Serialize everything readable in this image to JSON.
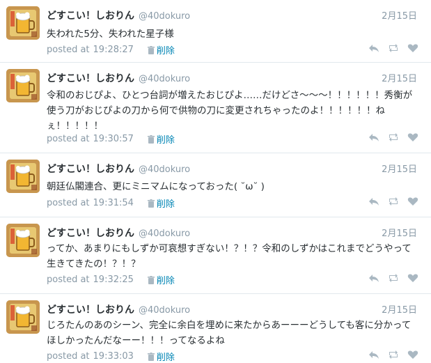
{
  "tweets": [
    {
      "name": "どすこい！しおりん",
      "handle": "@40dokuro",
      "date": "2月15日",
      "text": "失われた5分、失われた星子様",
      "posted_label": "posted at",
      "time": "19:28:27",
      "delete_label": "削除"
    },
    {
      "name": "どすこい！しおりん",
      "handle": "@40dokuro",
      "date": "2月15日",
      "text": "令和のおじぴよ、ひとつ台詞が増えたおじぴよ……だけどさ〜〜〜！！！！！！秀衡が使う刀がおじぴよの刀から何で供物の刀に変更されちゃったのよ！！！！！！ねぇ！！！！！",
      "posted_label": "posted at",
      "time": "19:30:57",
      "delete_label": "削除"
    },
    {
      "name": "どすこい！しおりん",
      "handle": "@40dokuro",
      "date": "2月15日",
      "text": "朝廷仏閣連合、更にミニマムになっておった( ˘ω˘ )",
      "posted_label": "posted at",
      "time": "19:31:54",
      "delete_label": "削除"
    },
    {
      "name": "どすこい！しおりん",
      "handle": "@40dokuro",
      "date": "2月15日",
      "text": "ってか、あまりにもしずか可哀想すぎない！？！？令和のしずかはこれまでどうやって生きてきたの！？！？",
      "posted_label": "posted at",
      "time": "19:32:25",
      "delete_label": "削除"
    },
    {
      "name": "どすこい！しおりん",
      "handle": "@40dokuro",
      "date": "2月15日",
      "text": "じろたんのあのシーン、完全に余白を埋めに来たからあーーーどうしても客に分かってほしかったんだなーー！！！ってなるよね",
      "posted_label": "posted at",
      "time": "19:33:03",
      "delete_label": "削除"
    }
  ],
  "icons": {
    "trash": "trash-icon",
    "reply": "reply-icon",
    "retweet": "retweet-icon",
    "favorite": "heart-icon"
  },
  "colors": {
    "link": "#0084b4",
    "muted": "#8899a6",
    "text": "#292f33",
    "divider": "#e1e8ed"
  }
}
